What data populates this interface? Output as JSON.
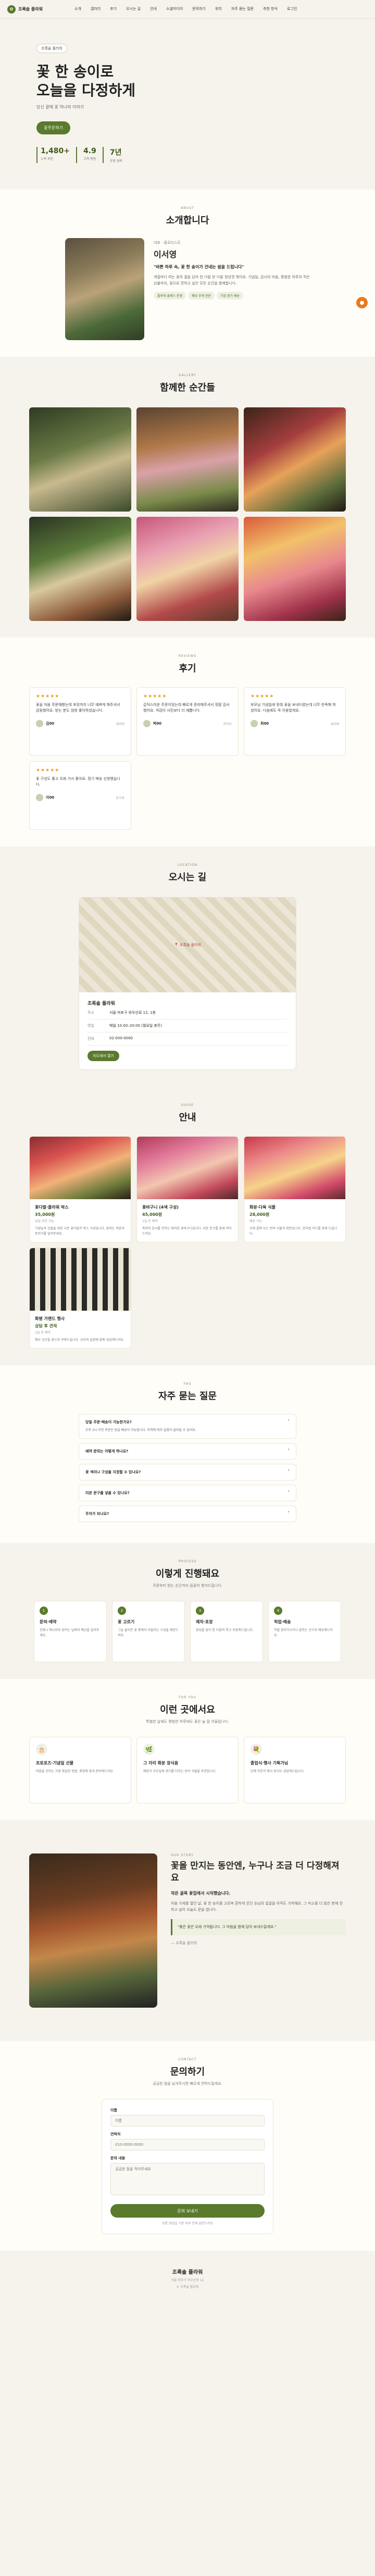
{
  "nav": {
    "brand": "조록솔 플라워",
    "items": [
      "소개",
      "갤러리",
      "후기",
      "오시는 길",
      "안내",
      "소셜미디어",
      "문의하기",
      "위치",
      "자주 묻는 질문",
      "추천 방식"
    ],
    "extra": "로그인"
  },
  "hero": {
    "pill": "조록솔 플라워",
    "title_line1": "꽃 한 송이로",
    "title_line2": "오늘을 다정하게",
    "subtitle": "당신 곁에 꽃 하나의 이야기",
    "cta": "꽃주문하기",
    "stats": [
      {
        "num": "1,480+",
        "label": "누적 주문"
      },
      {
        "num": "4.9",
        "label": "고객 평점"
      },
      {
        "num": "7년",
        "label": "운영 경력"
      }
    ]
  },
  "about": {
    "eyebrow": "ABOUT",
    "title": "소개합니다",
    "meta": "대표 · 플로리스트",
    "name": "이서영",
    "quote": "\"바쁜 하루 속, 꽃 한 송이가 건네는 쉼을 드립니다\"",
    "body": "계절마다 피는 꽃의 결을 담아 한 다발 한 다발 정성껏 엮어요. 기념일, 감사의 마음, 평범한 하루의 작은 선물까지, 꽃으로 전하고 싶은 모든 순간을 함께합니다.",
    "tags": [
      "플라워 클래스 운영",
      "웨딩 부케 전문",
      "기업 정기 배송"
    ]
  },
  "gallery": {
    "eyebrow": "GALLERY",
    "title": "함께한 순간들",
    "tiles": [
      "g1",
      "g2",
      "g3",
      "g4",
      "g5",
      "g6"
    ]
  },
  "reviews": {
    "eyebrow": "REVIEWS",
    "title": "후기",
    "items": [
      {
        "stars": "★★★★★",
        "text": "꽃을 처음 주문해봤는데 포장까지 너무 예쁘게 해주셔서 감동했어요. 받는 분도 엄청 좋아하셨습니다.",
        "name": "김00",
        "source": "네이버"
      },
      {
        "stars": "★★★★★",
        "text": "갑작스러운 주문이었는데 빠르게 준비해주셔서 정말 감사했어요. 색감이 사진보다 더 예쁩니다.",
        "name": "박00",
        "source": "카카오"
      },
      {
        "stars": "★★★★★",
        "text": "부모님 기념일에 맞춰 꽃을 보내드렸는데 너무 만족해 하셨어요. 다음에도 꼭 이용할게요.",
        "name": "최00",
        "source": "네이버"
      },
      {
        "stars": "★★★★★",
        "text": "꽃 구성도 좋고 오래 가서 좋아요. 정기 배송 신청했습니다.",
        "name": "이00",
        "source": "인스타"
      }
    ]
  },
  "location": {
    "eyebrow": "LOCATION",
    "title": "오시는 길",
    "map_label": "조록솔 플라워",
    "shop": "조록솔 플라워",
    "rows": [
      {
        "k": "주소",
        "v": "서울 마포구 와우산로 12, 1층"
      },
      {
        "k": "영업",
        "v": "매일 10:00–20:00 (월요일 휴무)"
      },
      {
        "k": "전화",
        "v": "02-000-0000"
      }
    ],
    "button": "지도에서 열기"
  },
  "services": {
    "eyebrow": "GUIDE",
    "title": "안내",
    "items": [
      {
        "name": "꽃다발·플라워 박스",
        "price": "35,000원",
        "note": "당일 주문 가능",
        "desc": "기념일과 선물을 위한 시즌 꽃다발과 박스 구성입니다. 원하는 색감과 분위기를 알려주세요."
      },
      {
        "name": "꽃바구니 (4색 구성)",
        "price": "45,000원",
        "note": "1일 전 예약",
        "desc": "축하와 감사를 전하는 화려한 꽃바구니입니다. 리본 문구를 함께 적어드려요."
      },
      {
        "name": "화분·다육 식물",
        "price": "28,000원",
        "note": "배송 가능",
        "desc": "오래 곁에 두는 반려 식물과 화분입니다. 관리법 카드를 함께 드립니다."
      },
      {
        "name": "화병 가랜드 행사",
        "price": "상담 후 견적",
        "note": "3일 전 예약",
        "desc": "행사 공간을 꽃으로 꾸며드립니다. 규모와 일정에 맞춰 상담해드려요."
      }
    ]
  },
  "faq": {
    "eyebrow": "FAQ",
    "title": "자주 묻는 질문",
    "items": [
      {
        "q": "당일 주문·배송이 가능한가요?",
        "a": "오후 3시 이전 주문은 당일 배송이 가능합니다. 지역에 따라 일정이 달라질 수 있어요."
      },
      {
        "q": "예약 문의는 어떻게 하나요?",
        "a": ""
      },
      {
        "q": "꽃 색이나 구성을 지정할 수 있나요?",
        "a": ""
      },
      {
        "q": "리본 문구를 넣을 수 있나요?",
        "a": ""
      },
      {
        "q": "주차가 되나요?",
        "a": ""
      }
    ]
  },
  "process": {
    "eyebrow": "PROCESS",
    "title": "이렇게 진행돼요",
    "desc": "주문부터 받는 순간까지 꼼꼼히 챙겨드립니다.",
    "steps": [
      {
        "n": "1",
        "title": "문의·예약",
        "desc": "전화나 메시지로 원하는 날짜와 예산을 알려주세요."
      },
      {
        "n": "2",
        "title": "꽃 고르기",
        "desc": "그날 들어온 꽃 중에서 어울리는 구성을 제안드려요."
      },
      {
        "n": "3",
        "title": "제작·포장",
        "desc": "정성을 담아 한 다발씩 엮고 포장해드립니다."
      },
      {
        "n": "4",
        "title": "픽업·배송",
        "desc": "직접 찾아가시거나 원하는 곳으로 배송해드려요."
      }
    ]
  },
  "recommend": {
    "eyebrow": "FOR YOU",
    "title": "이런 곳에서요",
    "desc": "특별한 날에도 평범한 하루에도 꽃은 늘 잘 어울립니다.",
    "items": [
      {
        "icon": "🎂",
        "title": "프로포즈·기념일 선물",
        "desc": "마음을 전하는 가장 확실한 방법. 취향에 맞게 준비해드려요."
      },
      {
        "icon": "🌿",
        "title": "그 자리 화분 장식용",
        "desc": "매장과 사무실에 생기를 더하는 반려 식물을 추천합니다."
      },
      {
        "icon": "💐",
        "title": "졸업식·행사 기획가님",
        "desc": "단체 주문과 행사 장식도 상담해드립니다."
      }
    ]
  },
  "story": {
    "eyebrow": "OUR STORY",
    "title": "꽃을 만지는 동안엔, 누구나 조금 더 다정해져요",
    "lead": "작은 골목 꽃집에서 시작했습니다.",
    "body": "처음 가게를 열던 날, 꽃 한 송이를 고르며 환하게 웃던 손님의 얼굴을 아직도 기억해요. 그 미소를 더 많은 분께 전하고 싶어 오늘도 문을 엽니다.",
    "quote": "\"좋은 꽃은 오래 기억됩니다. 그 마음을 함께 담아 보내드릴게요.\"",
    "sign": "— 조록솔 플라워"
  },
  "contact": {
    "eyebrow": "CONTACT",
    "title": "문의하기",
    "desc": "궁금한 점을 남겨주시면 빠르게 연락드릴게요.",
    "fields": [
      {
        "label": "이름",
        "placeholder": "이름"
      },
      {
        "label": "연락처",
        "placeholder": "010-0000-0000"
      }
    ],
    "message_label": "문의 내용",
    "message_placeholder": "궁금한 점을 적어주세요",
    "submit": "문의 보내기",
    "note": "보통 영업일 기준 하루 안에 답변드려요"
  },
  "footer": {
    "name": "조록솔 플라워",
    "line1": "서울 마포구 와우산로 12",
    "line2": "© 조록솔 플라워"
  },
  "colors": {
    "accent": "#5a7a2c",
    "bg": "#f6f3ec",
    "star": "#e3a21a"
  }
}
